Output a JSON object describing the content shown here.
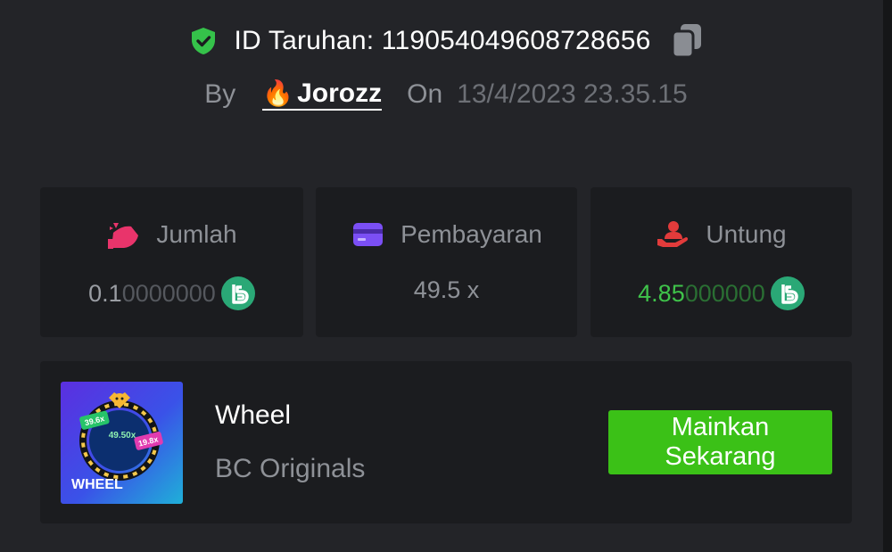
{
  "bet": {
    "id_label": "ID Taruhan: ",
    "id_value": "119054049608728656",
    "by_label": "By",
    "user_name": "Jorozz",
    "on_label": "On",
    "date": "13/4/2023 23.35.15"
  },
  "stats": {
    "amount": {
      "label": "Jumlah",
      "value_strong": "0.1",
      "value_dim": "0000000",
      "icon": "money-bag-icon",
      "icon_color": "#e9346b"
    },
    "payout": {
      "label": "Pembayaran",
      "value": "49.5 x",
      "icon": "credit-card-icon",
      "icon_color": "#7b4ff5"
    },
    "profit": {
      "label": "Untung",
      "value_strong": "4.85",
      "value_dim": "000000",
      "icon": "hand-person-icon",
      "icon_color": "#e23b3b"
    },
    "coin_icon": "bcd-coin-icon",
    "coin_color": "#2aa876"
  },
  "game": {
    "name": "Wheel",
    "provider": "BC Originals",
    "thumb_title": "WHEEL",
    "thumb_badges": [
      "39.6x",
      "49.50x",
      "19.8x"
    ],
    "play_line1": "Mainkan",
    "play_line2": "Sekarang",
    "play_color": "#3bc117"
  },
  "colors": {
    "background": "#232428",
    "card": "#1b1c1f",
    "verified": "#35c24a"
  }
}
